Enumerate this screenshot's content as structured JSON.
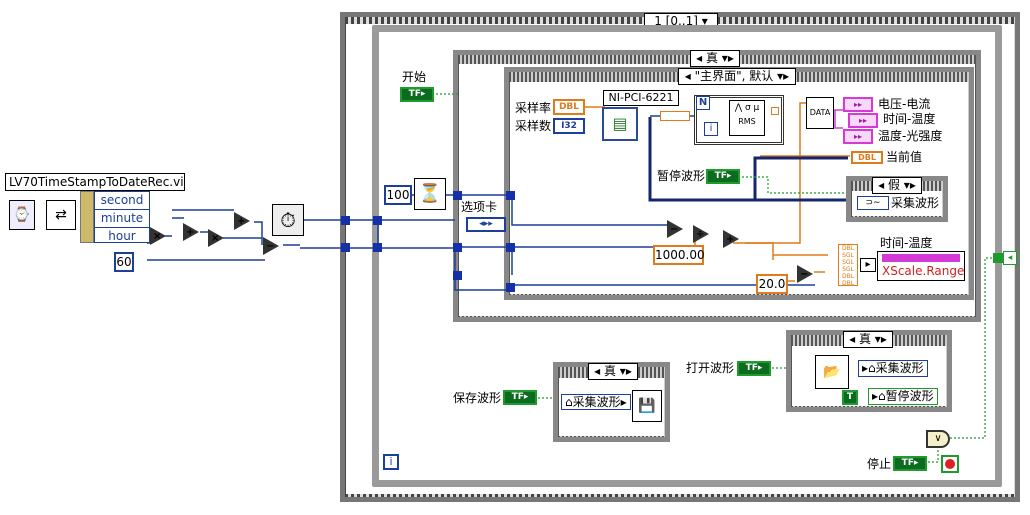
{
  "sequence": {
    "selector": "1 [0..1]"
  },
  "case_outer": {
    "selector": "真"
  },
  "case_event": {
    "selector": "\"主界面\", 默认"
  },
  "case_pause": {
    "selector": "假"
  },
  "case_open": {
    "selector": "真"
  },
  "case_save": {
    "selector": "真"
  },
  "subvi": {
    "title": "LV70TimeStampToDateRec.vi",
    "outputs": [
      "second",
      "minute",
      "hour"
    ]
  },
  "constants": {
    "sixty": "60",
    "hundred": "100",
    "thousand": "1000.00",
    "twenty": "20.0"
  },
  "labels": {
    "start": "开始",
    "tab": "选项卡",
    "sample_rate": "采样率",
    "sample_count": "采样数",
    "daq": "NI-PCI-6221",
    "rms": "RMS",
    "data": "DATA",
    "n": "N",
    "i": "i",
    "i_outer": "i",
    "voltage_current": "电压-电流",
    "time_temp": "时间-温度",
    "temp_light": "温度-光强度",
    "current_value": "当前值",
    "pause_wave": "暂停波形",
    "acq_wave": "采集波形",
    "time_temp2": "时间-温度",
    "xscale": "XScale.Range",
    "save_wave": "保存波形",
    "acq_wave_save": "采集波形",
    "open_wave": "打开波形",
    "acq_wave_open": "采集波形",
    "pause_wave_open": "暂停波形",
    "stop": "停止"
  },
  "types": {
    "dbl": "DBL",
    "i32": "I32",
    "tf": "TF"
  }
}
